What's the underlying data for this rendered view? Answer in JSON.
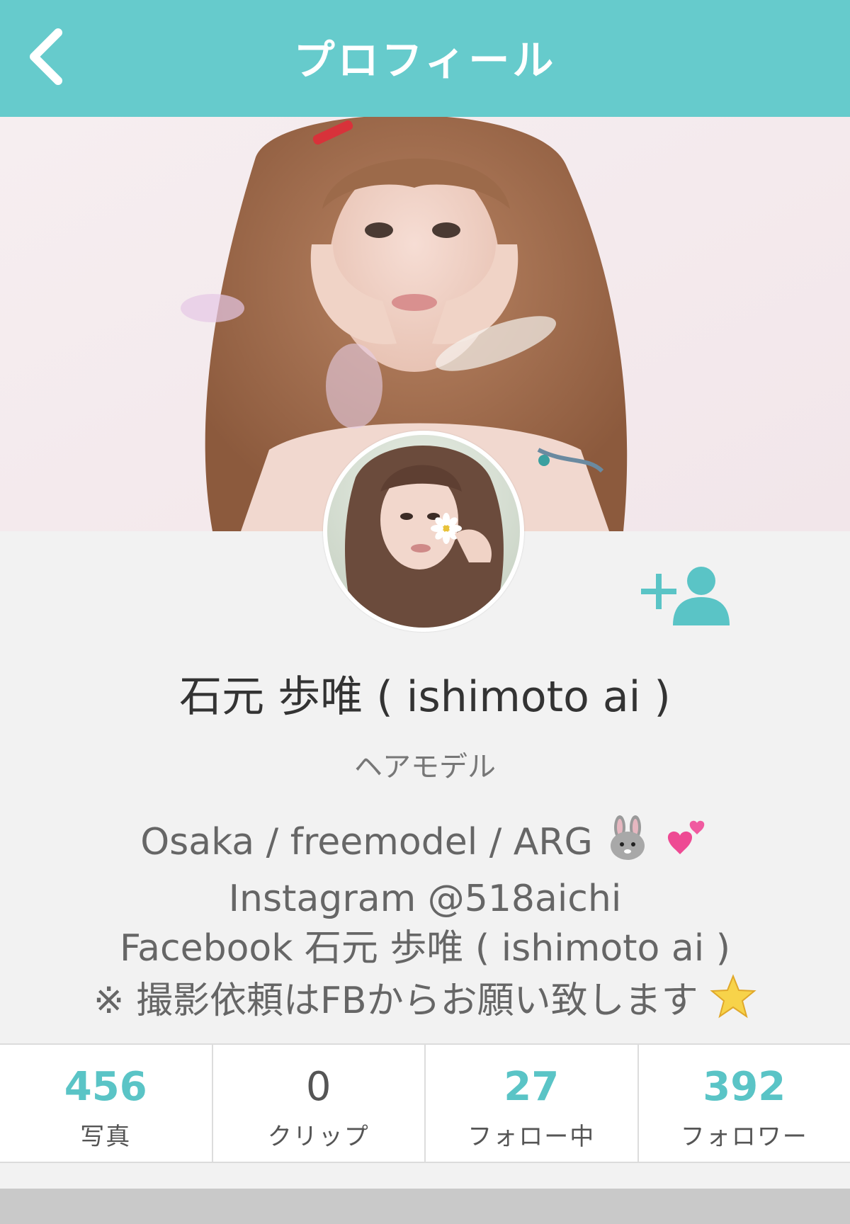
{
  "navbar": {
    "title": "プロフィール",
    "back_icon": "chevron-left-icon"
  },
  "colors": {
    "accent": "#66cbcc",
    "stat_number": "#5ac4c6",
    "background": "#f2f2f2"
  },
  "profile": {
    "name": "石元 歩唯 ( ishimoto ai )",
    "role": "ヘアモデル",
    "bio": {
      "line1": "Osaka / freemodel / ARG",
      "line2": "Instagram @518aichi",
      "line3": "Facebook 石元 歩唯 ( ishimoto ai )",
      "line4": "※ 撮影依頼はFBからお願い致します"
    },
    "follow_icon": "add-user-icon"
  },
  "stats": [
    {
      "value": "456",
      "label": "写真"
    },
    {
      "value": "0",
      "label": "クリップ"
    },
    {
      "value": "27",
      "label": "フォロー中"
    },
    {
      "value": "392",
      "label": "フォロワー"
    }
  ]
}
